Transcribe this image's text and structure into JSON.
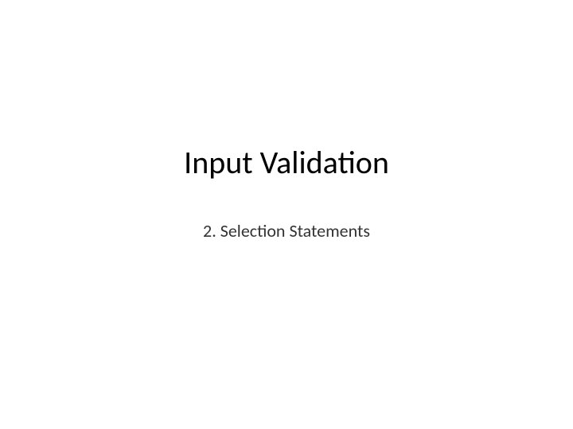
{
  "slide": {
    "title": "Input Validation",
    "subtitle": "2. Selection Statements"
  }
}
